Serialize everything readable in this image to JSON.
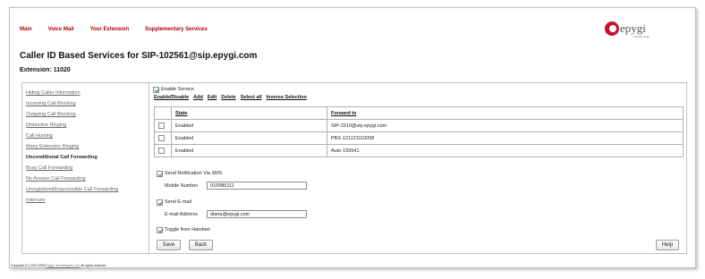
{
  "nav": {
    "main": "Main",
    "voice_mail": "Voice Mail",
    "your_extension": "Your Extension",
    "supplementary": "Supplementary Services"
  },
  "logo": {
    "word": "epygi",
    "tagline": "TQuadro4HE"
  },
  "page": {
    "title": "Caller ID Based Services for SIP-102561@sip.epygi.com",
    "extension": "Extension: 11020"
  },
  "sidebar": {
    "items": [
      {
        "label": "Hiding Caller Information",
        "active": false
      },
      {
        "label": "Incoming Call Blocking",
        "active": false
      },
      {
        "label": "Outgoing Call Blocking",
        "active": false
      },
      {
        "label": "Distinctive Ringing",
        "active": false
      },
      {
        "label": "Call Hunting",
        "active": false
      },
      {
        "label": "Many Extension Ringing",
        "active": false
      },
      {
        "label": "Unconditional Call Forwarding",
        "active": true
      },
      {
        "label": "Busy Call Forwarding",
        "active": false
      },
      {
        "label": "No Answer Call Forwarding",
        "active": false
      },
      {
        "label": "Unregistered/Inaccessible Call Forwarding",
        "active": false
      },
      {
        "label": "Intercom",
        "active": false
      }
    ]
  },
  "form": {
    "enable_service": {
      "label": "Enable Service",
      "checked": true
    },
    "toolbar": {
      "enable_disable": "Enable/Disable",
      "add": "Add",
      "edit": "Edit",
      "delete": "Delete",
      "select_all": "Select all",
      "inverse": "Inverse Selection"
    },
    "table": {
      "headers": [
        "State",
        "Forward to"
      ],
      "rows": [
        {
          "state": "Enabled",
          "forward": "SIP-1510@sip.epygi.com"
        },
        {
          "state": "Enabled",
          "forward": "PBX-121121110098"
        },
        {
          "state": "Enabled",
          "forward": "Auto-159541"
        }
      ]
    },
    "sms": {
      "label": "Send Notification Via SMS",
      "checked": true,
      "mobile_label": "Mobile Number",
      "mobile_value": "015985111"
    },
    "email": {
      "label": "Send E-mail",
      "checked": true,
      "address_label": "E-mail Address",
      "address_value": "diana@epygi.com"
    },
    "toggle": {
      "label": "Toggle from Handset",
      "checked": true
    },
    "buttons": {
      "save": "Save",
      "back": "Back",
      "help": "Help"
    }
  },
  "footer": {
    "prefix": "Copyright (C) 2003-2009",
    "company": "Epygi Technologies, Ltd.",
    "suffix": "All rights reserved."
  },
  "colors": {
    "nav_red": "#b30000",
    "brand_red": "#c4122f",
    "check_green": "#2f7d2f"
  }
}
